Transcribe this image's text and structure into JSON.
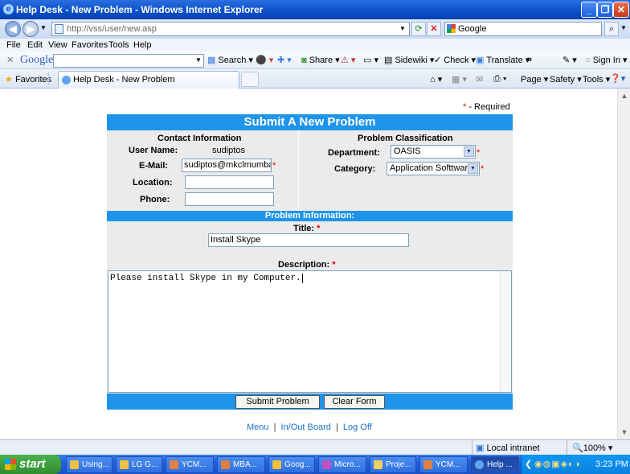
{
  "window": {
    "title": "Help Desk - New Problem - Windows Internet Explorer"
  },
  "address": {
    "url": "http://vss/user/new.asp",
    "search_engine": "Google"
  },
  "menu": [
    "File",
    "Edit",
    "View",
    "Favorites",
    "Tools",
    "Help"
  ],
  "google_toolbar": {
    "logo": "Google",
    "items": [
      "Search",
      "Share",
      "Sidewiki",
      "Check",
      "Translate",
      "Sign In"
    ]
  },
  "favorites_bar": {
    "favorites_label": "Favorites",
    "tab_label": "Help Desk - New Problem",
    "commands": [
      "Page",
      "Safety",
      "Tools"
    ]
  },
  "form": {
    "required_marker": "*",
    "required_note": " - Required",
    "header": "Submit A New Problem",
    "contact": {
      "heading": "Contact Information",
      "user_name_label": "User Name:",
      "user_name_value": "sudiptos",
      "email_label": "E-Mail:",
      "email_value": "sudiptos@mkclmumbai",
      "location_label": "Location:",
      "location_value": "",
      "phone_label": "Phone:",
      "phone_value": ""
    },
    "classification": {
      "heading": "Problem Classification",
      "department_label": "Department:",
      "department_value": "OASIS",
      "category_label": "Category:",
      "category_value": "Application Softtware"
    },
    "problem_info_heading": "Problem Information:",
    "title_label": "Title:",
    "title_value": "Install Skype",
    "description_label": "Description:",
    "description_value": "Please install Skype in my Computer.",
    "submit_label": "Submit Problem",
    "clear_label": "Clear Form"
  },
  "footer_links": {
    "menu": "Menu",
    "sep": "|",
    "inout": "In/Out Board",
    "logoff": "Log Off"
  },
  "status": {
    "zone": "Local intranet",
    "zoom": "100%"
  },
  "taskbar": {
    "start_label": "start",
    "tasks": [
      "Using...",
      "LG G...",
      "YCM...",
      "MBA...",
      "Goog...",
      "Micro...",
      "Proje...",
      "YCM...",
      "Help ..."
    ],
    "clock": "3:23 PM"
  },
  "colors": {
    "form_header_bg": "#1e94ea",
    "panel_bg": "#ebebeb",
    "required": "#e00000",
    "link": "#1a73c8"
  }
}
